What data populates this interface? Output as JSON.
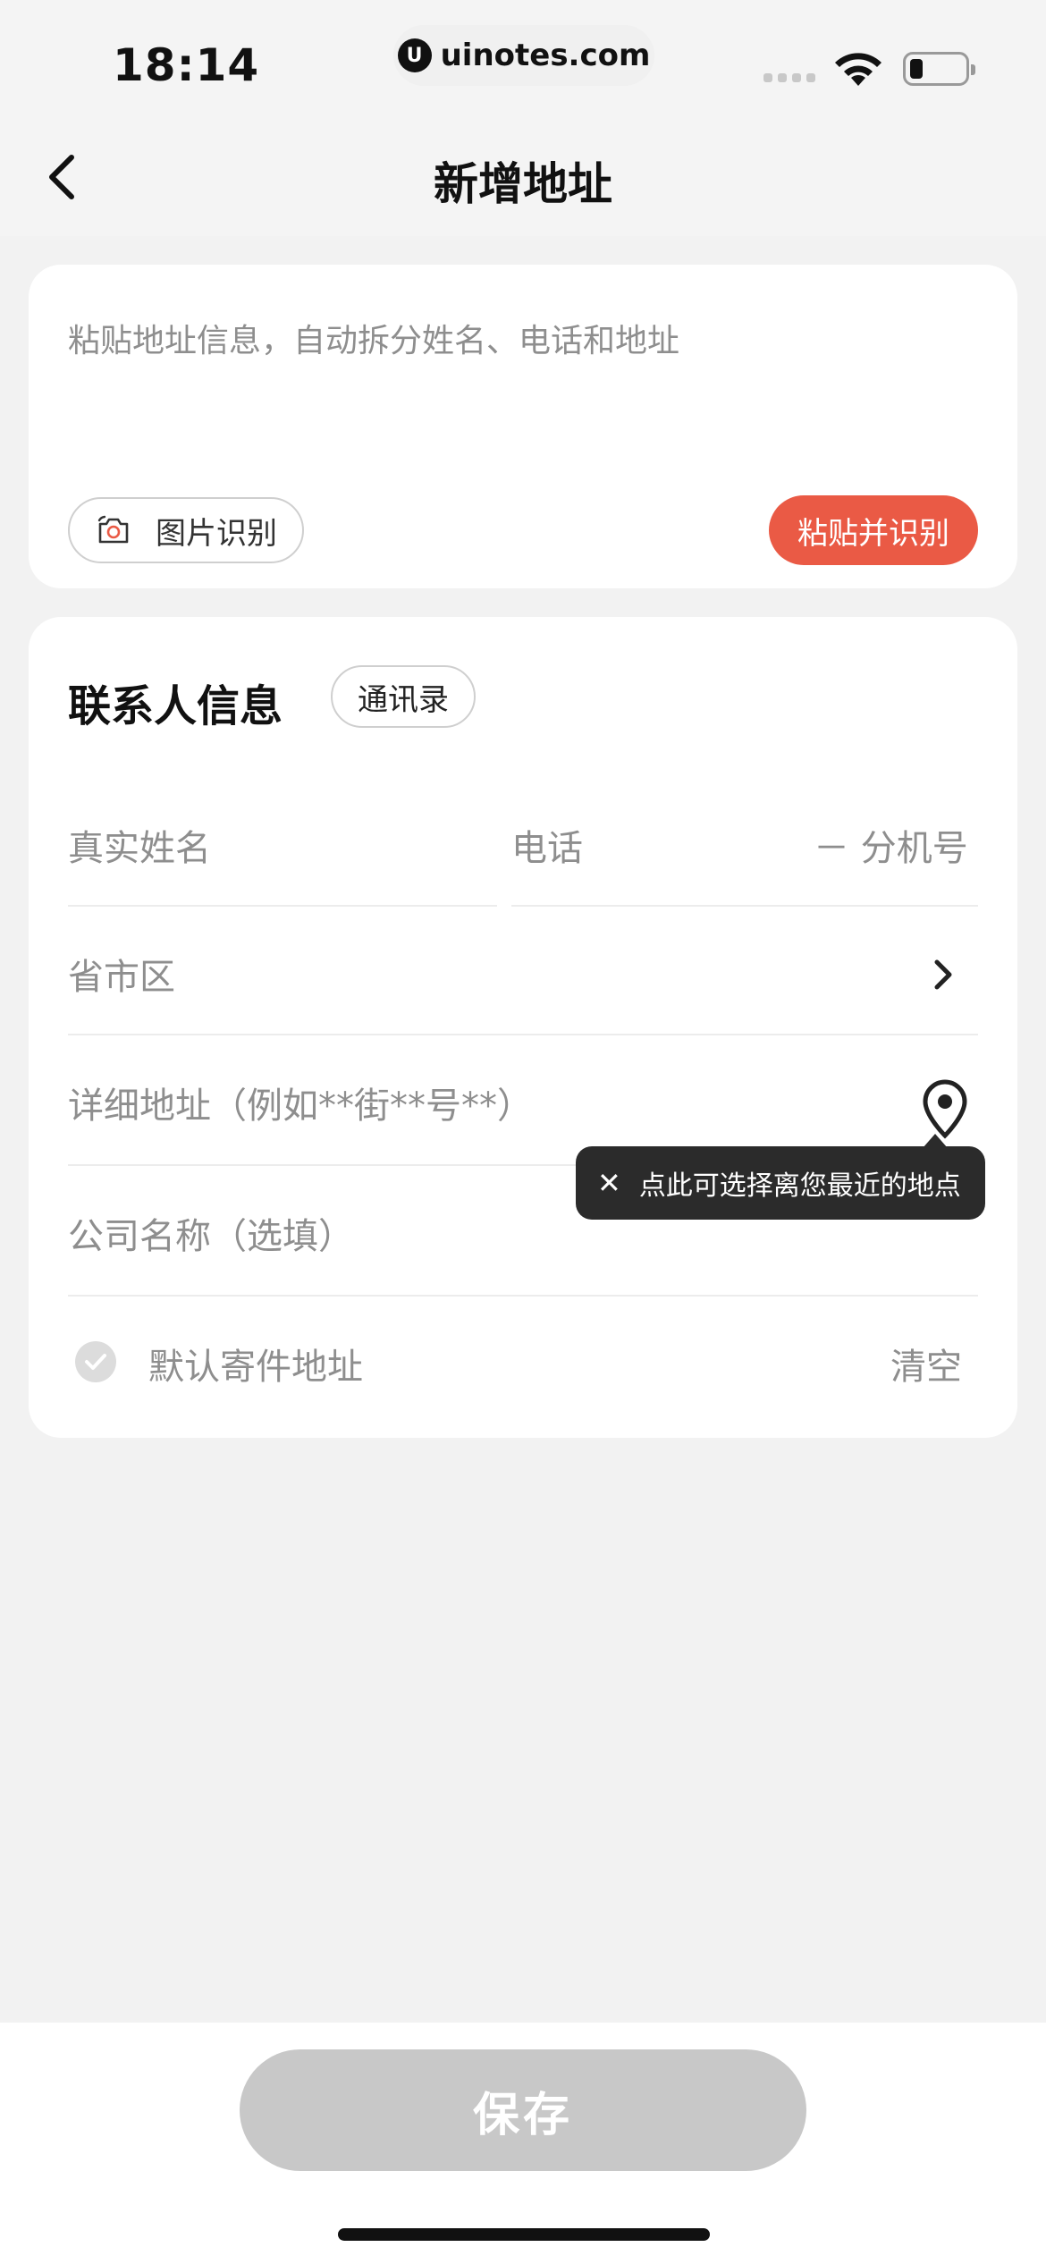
{
  "status_bar": {
    "time": "18:14",
    "url": "uinotes.com",
    "url_logo_glyph": "U"
  },
  "nav": {
    "title": "新增地址",
    "back_icon": "chevron-left-icon"
  },
  "paste_card": {
    "placeholder": "粘贴地址信息，自动拆分姓名、电话和地址",
    "image_recognize_label": "图片识别",
    "paste_recognize_label": "粘贴并识别",
    "accent_color": "#ea5a45"
  },
  "contact": {
    "section_title": "联系人信息",
    "contacts_button_label": "通讯录",
    "name_placeholder": "真实姓名",
    "phone_placeholder": "电话",
    "extension_placeholder": "－ 分机号",
    "region_placeholder": "省市区",
    "address_placeholder": "详细地址（例如**街**号**）",
    "company_placeholder": "公司名称（选填）",
    "tooltip_text": "点此可选择离您最近的地点",
    "tooltip_close": "✕",
    "default_label": "默认寄件地址",
    "clear_label": "清空"
  },
  "footer": {
    "save_label": "保存"
  }
}
